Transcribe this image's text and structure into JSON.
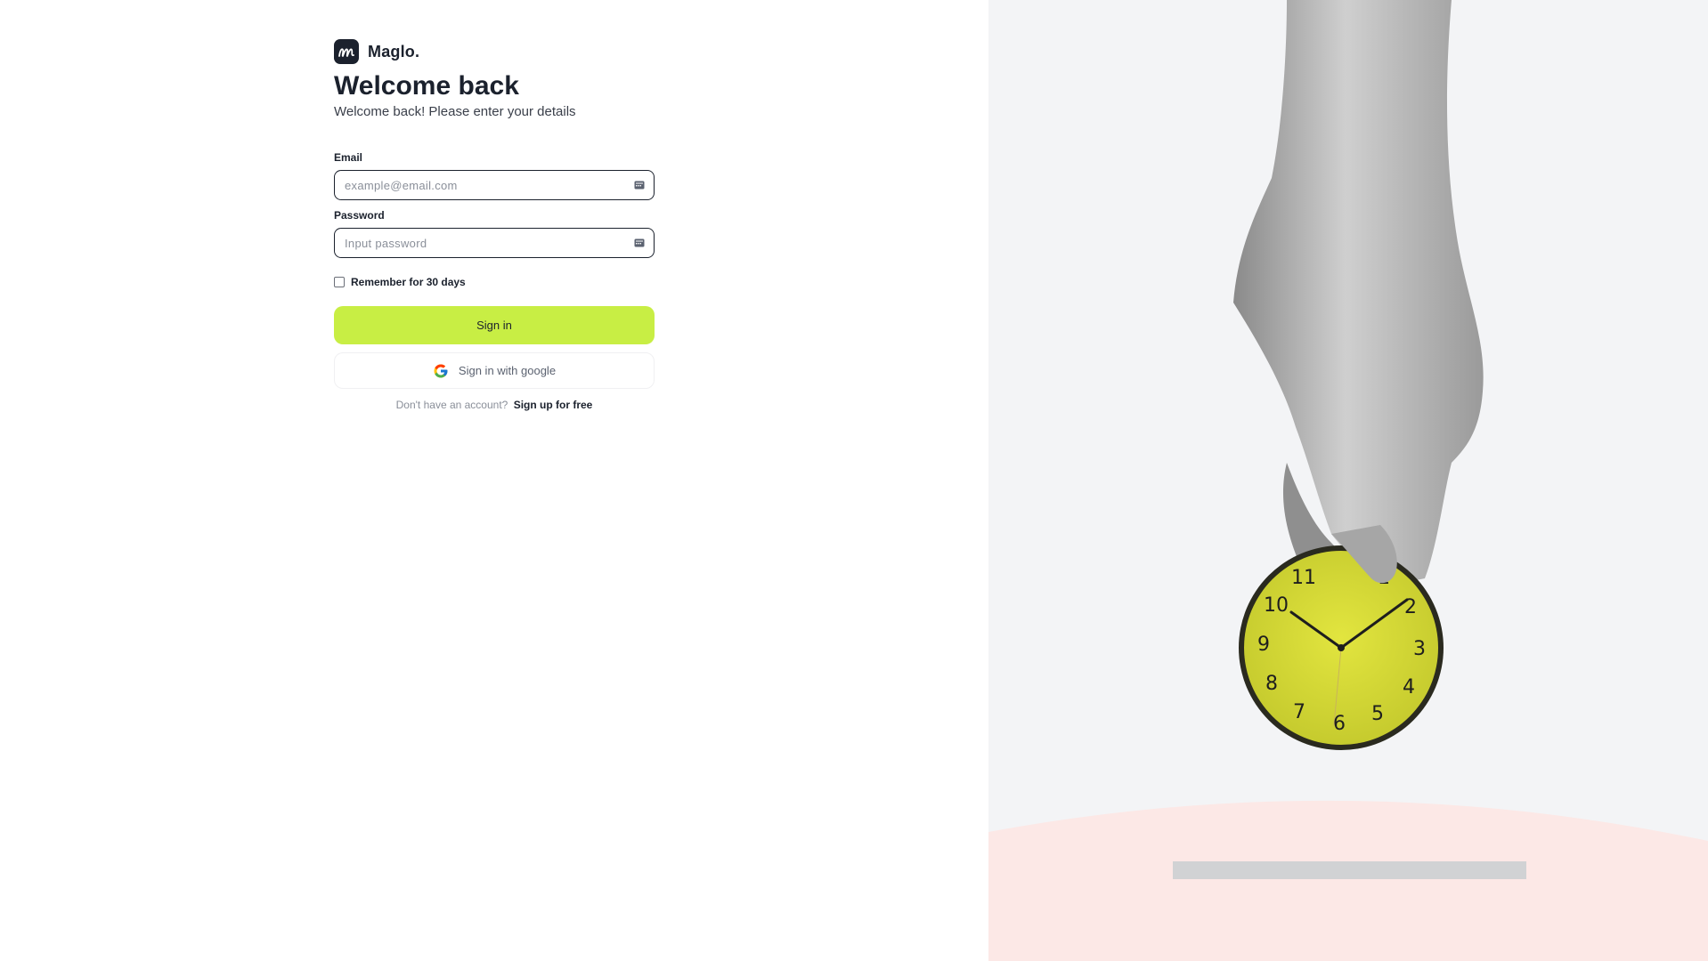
{
  "brand": {
    "name": "Maglo."
  },
  "header": {
    "title": "Welcome back",
    "subtitle": "Welcome back! Please enter your details"
  },
  "form": {
    "email": {
      "label": "Email",
      "placeholder": "example@email.com",
      "value": ""
    },
    "password": {
      "label": "Password",
      "placeholder": "Input password",
      "value": ""
    },
    "remember": {
      "label": "Remember for 30 days",
      "checked": false
    },
    "signin_label": "Sign in",
    "google_label": "Sign in with google"
  },
  "footer": {
    "prompt": "Don't have an account?",
    "signup_label": "Sign up for free"
  },
  "hero": {
    "clock_numerals": [
      "11",
      "1",
      "2",
      "10",
      "9",
      "3",
      "8",
      "4",
      "7",
      "5",
      "6"
    ]
  },
  "colors": {
    "accent": "#c8ee44",
    "text_dark": "#1b212d",
    "muted": "#8a8f99",
    "hero_bg": "#f3f4f6",
    "hero_pink": "#fce8e6",
    "clock_face": "#d9df3a"
  },
  "icons": {
    "brand": "maglo-logo-icon",
    "email_field": "password-manager-key-icon",
    "password_field": "password-manager-key-icon",
    "google": "google-icon"
  }
}
